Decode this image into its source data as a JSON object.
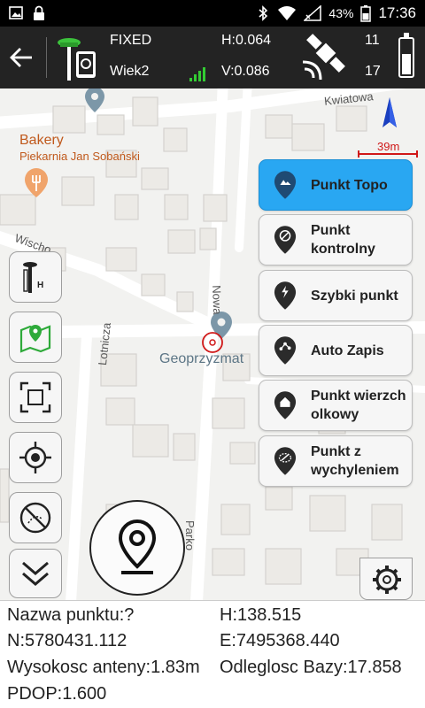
{
  "status_bar": {
    "battery": "43%",
    "time": "17:36"
  },
  "header": {
    "fix_status": "FIXED",
    "point_name": "Wiek2",
    "h_precision": "H:0.064",
    "v_precision": "V:0.086",
    "satellites_tracked": "11",
    "satellites_used": "17",
    "battery_level": 0.55
  },
  "map": {
    "labels": {
      "bakery": "Bakery",
      "bakery_sub": "Piekarnia Jan Sobański",
      "kwiatowa": "Kwiatowa",
      "wischo": "Wischo",
      "nowa": "Nowa",
      "lotnicza": "Lotnicza",
      "parko": "Parko",
      "geoprzyzmat": "Geoprzyzmat"
    },
    "scale": "39m"
  },
  "menu": {
    "items": [
      {
        "label": "Punkt Topo",
        "icon": "terrain-pin-icon",
        "active": true
      },
      {
        "label": "Punkt kontrolny",
        "icon": "control-pin-icon",
        "active": false
      },
      {
        "label": "Szybki punkt",
        "icon": "lightning-pin-icon",
        "active": false
      },
      {
        "label": "Auto Zapis",
        "icon": "auto-record-pin-icon",
        "active": false
      },
      {
        "label": "Punkt wierzch olkowy",
        "icon": "house-pin-icon",
        "active": false
      },
      {
        "label": "Punkt z wychyleniem",
        "icon": "tilt-pin-icon",
        "active": false
      }
    ]
  },
  "info": {
    "point_name": "Nazwa punktu:?",
    "h": "H:138.515",
    "n": "N:5780431.112",
    "e": "E:7495368.440",
    "antenna": "Wysokosc anteny:1.83m",
    "base_distance": "Odleglosc Bazy:17.858",
    "pdop": "PDOP:1.600"
  }
}
